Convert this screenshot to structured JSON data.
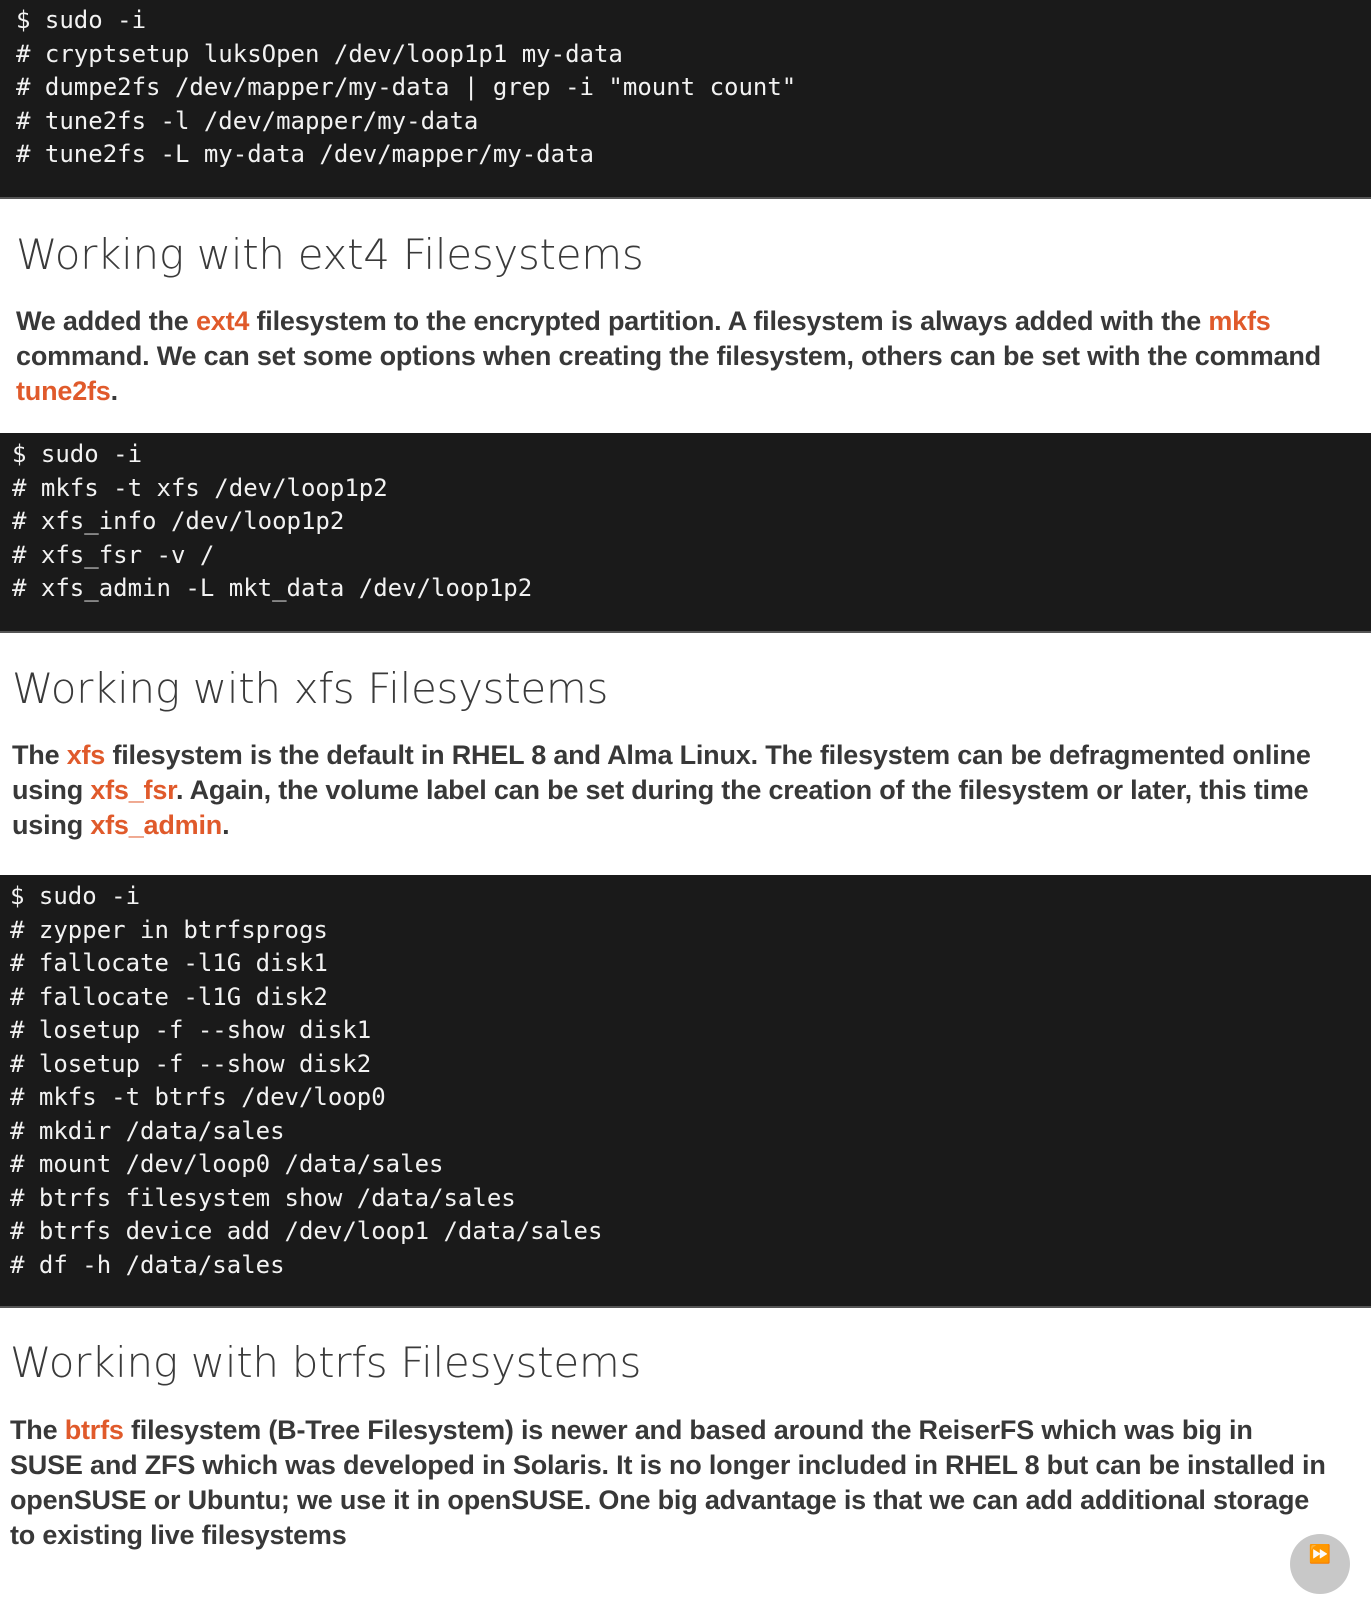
{
  "sections": [
    {
      "code": [
        "$ sudo -i",
        "# cryptsetup luksOpen /dev/loop1p1 my-data",
        "# dumpe2fs /dev/mapper/my-data | grep -i \"mount count\"",
        "# tune2fs -l /dev/mapper/my-data",
        "# tune2fs -L my-data /dev/mapper/my-data"
      ],
      "heading": "Working with ext4 Filesystems",
      "paragraph": [
        {
          "t": "We added the ",
          "hl": false
        },
        {
          "t": "ext4",
          "hl": true
        },
        {
          "t": " filesystem to the encrypted partition. A filesystem is always added with the ",
          "hl": false
        },
        {
          "t": "mkfs",
          "hl": true
        },
        {
          "t": " command. We can set some options when creating the filesystem, others can be set with the command ",
          "hl": false
        },
        {
          "t": "tune2fs",
          "hl": true
        },
        {
          "t": ".",
          "hl": false
        }
      ]
    },
    {
      "code": [
        "$ sudo -i",
        "# mkfs -t xfs /dev/loop1p2",
        "# xfs_info /dev/loop1p2",
        "# xfs_fsr -v /",
        "# xfs_admin -L mkt_data /dev/loop1p2"
      ],
      "heading": "Working with xfs Filesystems",
      "paragraph": [
        {
          "t": "The ",
          "hl": false
        },
        {
          "t": "xfs",
          "hl": true
        },
        {
          "t": " filesystem is the default in RHEL 8 and Alma Linux. The filesystem can be defragmented online using ",
          "hl": false
        },
        {
          "t": "xfs_fsr",
          "hl": true
        },
        {
          "t": ". Again, the volume label can be set during the creation of the filesystem or later, this time using ",
          "hl": false
        },
        {
          "t": "xfs_admin",
          "hl": true
        },
        {
          "t": ".",
          "hl": false
        }
      ]
    },
    {
      "code": [
        "$ sudo -i",
        "# zypper in btrfsprogs",
        "# fallocate -l1G disk1",
        "# fallocate -l1G disk2",
        "# losetup -f --show disk1",
        "# losetup -f --show disk2",
        "# mkfs -t btrfs /dev/loop0",
        "# mkdir /data/sales",
        "# mount /dev/loop0 /data/sales",
        "# btrfs filesystem show /data/sales",
        "# btrfs device add /dev/loop1 /data/sales",
        "# df -h /data/sales"
      ],
      "heading": "Working with btrfs Filesystems",
      "paragraph": [
        {
          "t": "The ",
          "hl": false
        },
        {
          "t": "btrfs",
          "hl": true
        },
        {
          "t": " filesystem (B-Tree Filesystem) is newer and based around the ReiserFS which was big in SUSE and ZFS which was developed in Solaris. It is no longer included in RHEL 8 but can be installed in openSUSE or Ubuntu; we use it in openSUSE. One big advantage is that we can add additional storage to existing live filesystems",
          "hl": false
        }
      ]
    }
  ],
  "colors": {
    "accent": "#e05a2b",
    "code_bg": "#1a1a1a",
    "text": "#383838"
  },
  "fab_icon": "fast-forward-icon"
}
